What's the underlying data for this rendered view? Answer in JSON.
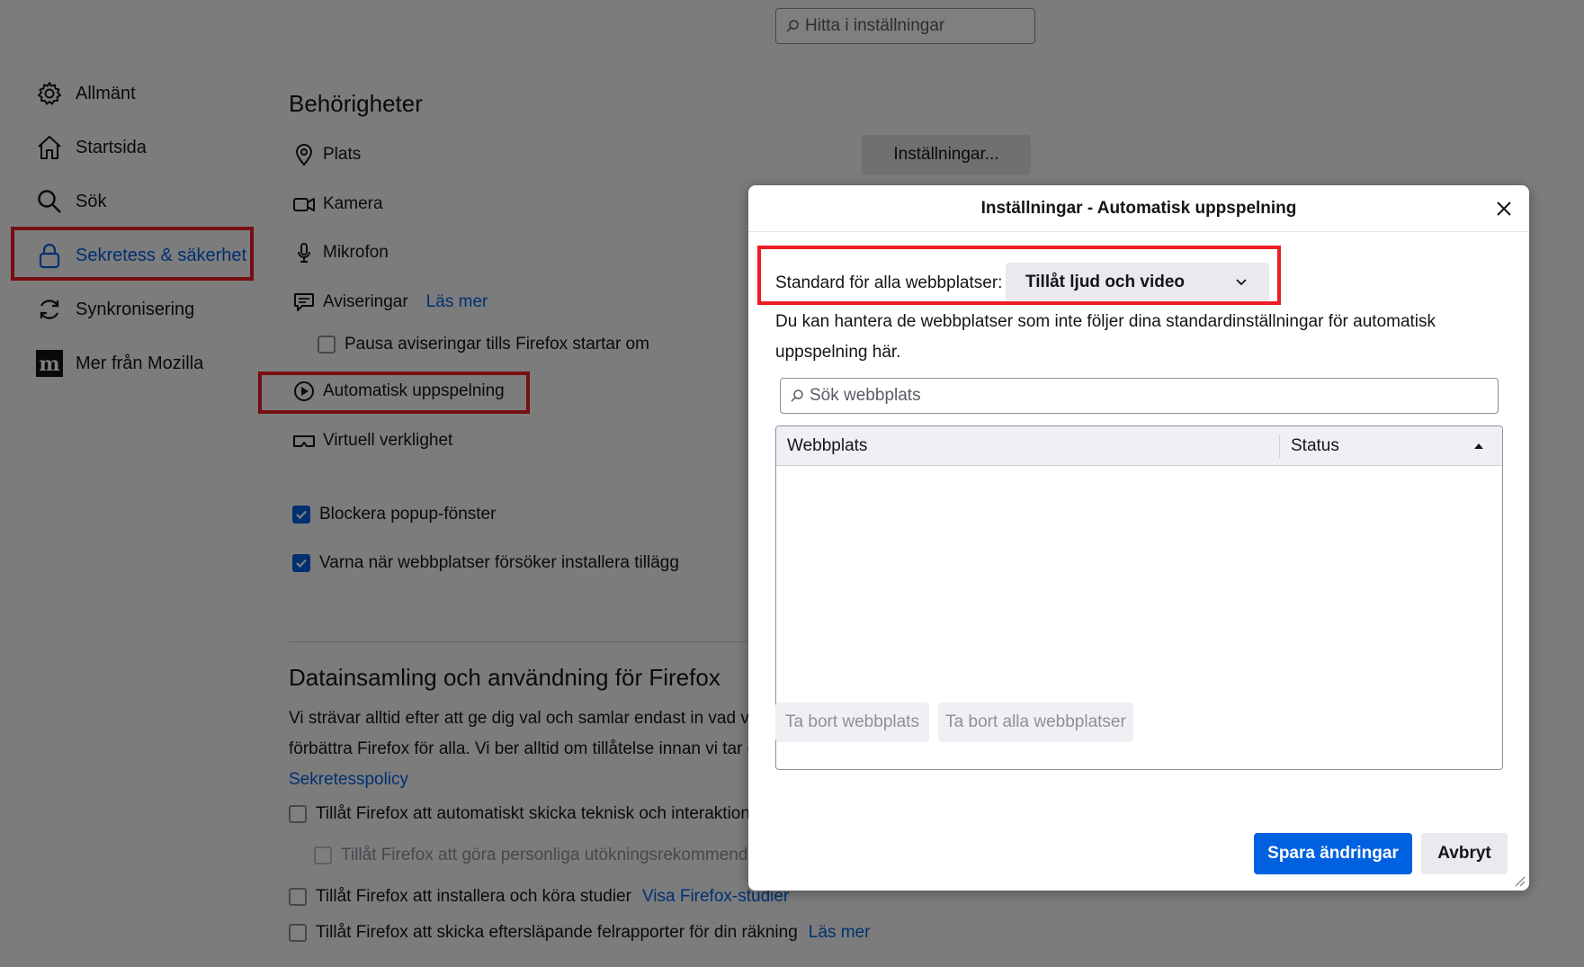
{
  "search": {
    "placeholder": "Hitta i inställningar"
  },
  "sidebar": {
    "items": [
      {
        "label": "Allmänt",
        "icon": "gear-icon"
      },
      {
        "label": "Startsida",
        "icon": "home-icon"
      },
      {
        "label": "Sök",
        "icon": "search-icon"
      },
      {
        "label": "Sekretess & säkerhet",
        "icon": "lock-icon",
        "active": true
      },
      {
        "label": "Synkronisering",
        "icon": "sync-icon"
      },
      {
        "label": "Mer från Mozilla",
        "icon": "mozilla-icon"
      }
    ]
  },
  "permissions": {
    "title": "Behörigheter",
    "settings_button": "Inställningar...",
    "items": {
      "location": "Plats",
      "camera": "Kamera",
      "microphone": "Mikrofon",
      "notifications": "Aviseringar",
      "notifications_link": "Läs mer",
      "pause_notifications": "Pausa aviseringar tills Firefox startar om",
      "autoplay": "Automatisk uppspelning",
      "vr": "Virtuell verklighet"
    },
    "block_popups": "Blockera popup-fönster",
    "warn_addons": "Varna när webbplatser försöker installera tillägg"
  },
  "data_collection": {
    "title": "Datainsamling och användning för Firefox",
    "text_line1": "Vi strävar alltid efter att ge dig val och samlar endast in vad vi",
    "text_line2": "förbättra Firefox för alla. Vi ber alltid om tillåtelse innan vi tar e",
    "policy_link": "Sekretesspolicy",
    "opt_telemetry": "Tillåt Firefox att automatiskt skicka teknisk och interaktions",
    "opt_recommendations": "Tillåt Firefox att göra personliga utökningsrekommenda",
    "opt_studies": "Tillåt Firefox att installera och köra studier",
    "opt_studies_link": "Visa Firefox-studier",
    "opt_crash": "Tillåt Firefox att skicka eftersläpande felrapporter för din räkning",
    "opt_crash_link": "Läs mer"
  },
  "dialog": {
    "title": "Inställningar - Automatisk uppspelning",
    "default_label": "Standard för alla webbplatser:",
    "default_value": "Tillåt ljud och video",
    "description_line1": "Du kan hantera de webbplatser som inte följer dina standardinställningar för automatisk",
    "description_line2": "uppspelning här.",
    "search_placeholder": "Sök webbplats",
    "col_site": "Webbplats",
    "col_status": "Status",
    "remove_site": "Ta bort webbplats",
    "remove_all": "Ta bort alla webbplatser",
    "save": "Spara ändringar",
    "cancel": "Avbryt"
  },
  "colors": {
    "accent": "#0061e0",
    "highlight_box": "#ee1c25"
  }
}
